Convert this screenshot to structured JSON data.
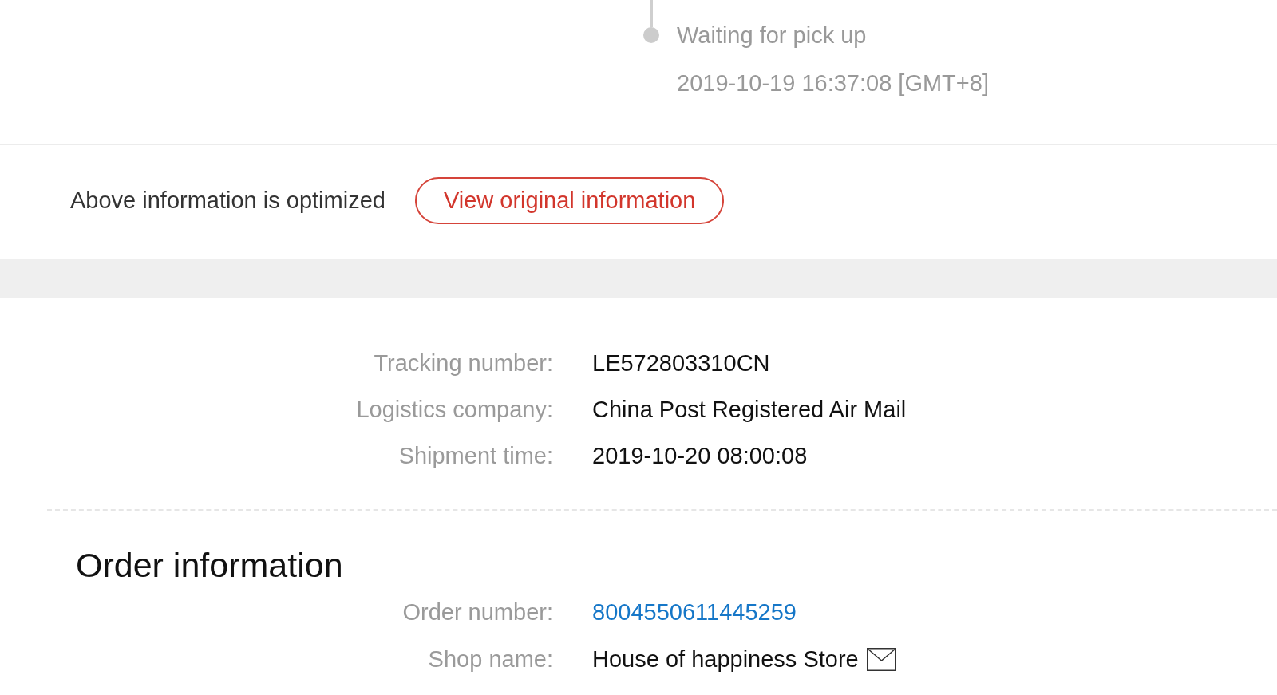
{
  "timeline": {
    "events": [
      {
        "status": "Waiting for pick up",
        "time": "2019-10-19 16:37:08 [GMT+8]"
      }
    ]
  },
  "notice": {
    "text": "Above information is optimized",
    "button": "View original information"
  },
  "shipment": {
    "fields": [
      {
        "label": "Tracking number:",
        "value": "LE572803310CN",
        "kind": "text"
      },
      {
        "label": "Logistics company:",
        "value": "China Post Registered Air Mail",
        "kind": "text"
      },
      {
        "label": "Shipment time:",
        "value": "2019-10-20 08:00:08",
        "kind": "text"
      }
    ]
  },
  "order": {
    "title": "Order information",
    "fields": [
      {
        "label": "Order number:",
        "value": "8004550611445259",
        "kind": "link"
      },
      {
        "label": "Shop name:",
        "value": "House of happiness Store",
        "kind": "contact"
      }
    ]
  }
}
